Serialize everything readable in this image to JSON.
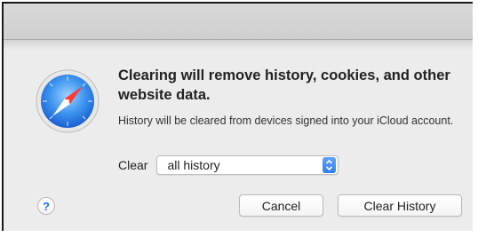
{
  "dialog": {
    "heading": "Clearing will remove history, cookies, and other website data.",
    "info": "History will be cleared from devices signed into your iCloud account.",
    "clear_label": "Clear",
    "clear_select": {
      "value": "all history"
    },
    "help_label": "?",
    "cancel_label": "Cancel",
    "confirm_label": "Clear History"
  },
  "icons": {
    "app": "safari-compass-icon",
    "help": "help-icon",
    "select_arrows": "up-down-chevron-icon"
  },
  "colors": {
    "accent": "#2f7ef2",
    "background": "#ececec"
  }
}
